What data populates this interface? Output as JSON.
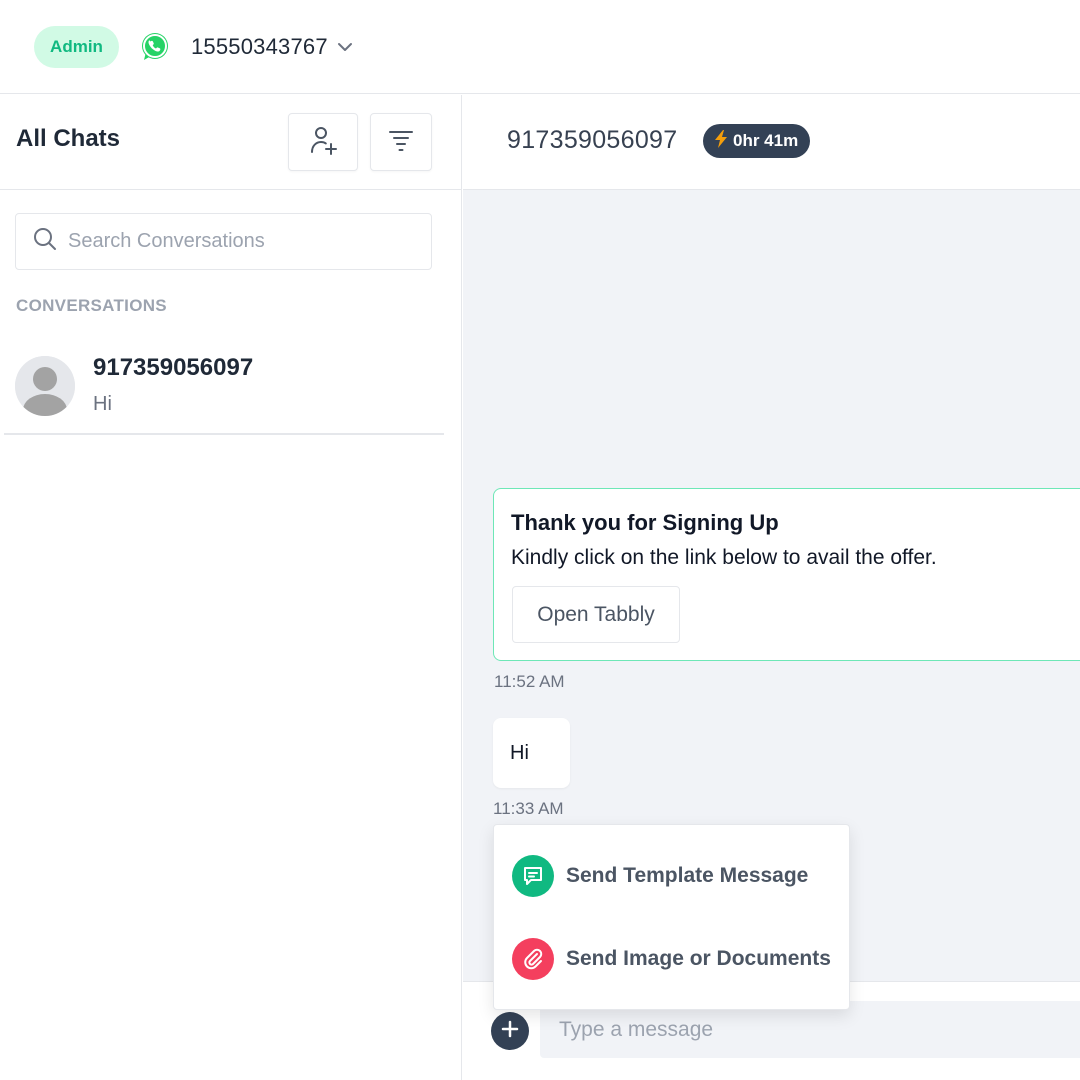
{
  "topbar": {
    "role_badge": "Admin",
    "phone_number": "15550343767",
    "icons": {
      "whatsapp": "whatsapp-icon",
      "dropdown": "chevron-down-icon"
    }
  },
  "sidebar": {
    "title": "All Chats",
    "search_placeholder": "Search Conversations",
    "section_heading": "CONVERSATIONS",
    "conversations": [
      {
        "name": "917359056097",
        "preview": "Hi"
      }
    ],
    "icons": {
      "add_contact": "add-user-icon",
      "filter": "filter-icon",
      "search": "search-icon",
      "avatar": "default-avatar-icon"
    }
  },
  "chat": {
    "title": "917359056097",
    "timer": "0hr 41m",
    "messages": [
      {
        "type": "template",
        "title": "Thank you for Signing Up",
        "body": "Kindly click on the link below to avail the offer.",
        "button": "Open Tabbly",
        "time": "11:52 AM"
      },
      {
        "type": "text",
        "text": "Hi",
        "time": "11:33 AM"
      }
    ],
    "composer_placeholder": "Type a message"
  },
  "attach_menu": {
    "items": [
      {
        "label": "Send Template Message",
        "icon": "message-icon",
        "color": "#10b981"
      },
      {
        "label": "Send Image or Documents",
        "icon": "paperclip-icon",
        "color": "#f43f5e"
      }
    ]
  },
  "colors": {
    "accent_green": "#10b981",
    "badge_bg": "#d1fae5",
    "dark_slate": "#334155",
    "timer_bolt": "#f59e0b"
  }
}
